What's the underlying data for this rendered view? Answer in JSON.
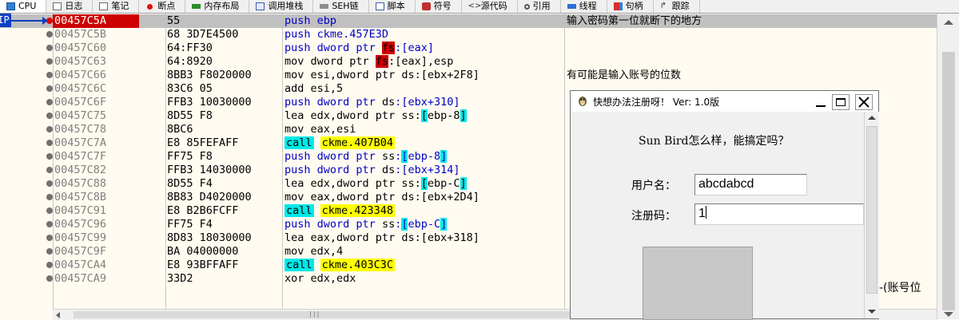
{
  "tabs": [
    {
      "label": "CPU",
      "icon": "cpu-icon"
    },
    {
      "label": "日志",
      "icon": "log-icon"
    },
    {
      "label": "笔记",
      "icon": "notes-icon"
    },
    {
      "label": "断点",
      "icon": "breakpoint-icon"
    },
    {
      "label": "内存布局",
      "icon": "memory-map-icon"
    },
    {
      "label": "调用堆栈",
      "icon": "call-stack-icon"
    },
    {
      "label": "SEH链",
      "icon": "seh-chain-icon"
    },
    {
      "label": "脚本",
      "icon": "script-icon"
    },
    {
      "label": "符号",
      "icon": "symbols-icon"
    },
    {
      "label": "源代码",
      "icon": "source-icon"
    },
    {
      "label": "引用",
      "icon": "references-icon"
    },
    {
      "label": "线程",
      "icon": "threads-icon"
    },
    {
      "label": "句柄",
      "icon": "handles-icon"
    },
    {
      "label": "跟踪",
      "icon": "trace-icon"
    }
  ],
  "eip_label": "EIP",
  "disasm": {
    "rows": [
      {
        "addr": "00457C5A",
        "bytes": "55",
        "comment": "输入密码第一位就断下的地方"
      },
      {
        "addr": "00457C5B",
        "bytes": "68 3D7E4500",
        "comment": ""
      },
      {
        "addr": "00457C60",
        "bytes": "64:FF30",
        "comment": ""
      },
      {
        "addr": "00457C63",
        "bytes": "64:8920",
        "comment": ""
      },
      {
        "addr": "00457C66",
        "bytes": "8BB3 F8020000",
        "comment": "有可能是输入账号的位数"
      },
      {
        "addr": "00457C6C",
        "bytes": "83C6 05",
        "comment": ""
      },
      {
        "addr": "00457C6F",
        "bytes": "FFB3 10030000",
        "comment": ""
      },
      {
        "addr": "00457C75",
        "bytes": "8D55 F8",
        "comment": ""
      },
      {
        "addr": "00457C78",
        "bytes": "8BC6",
        "comment": ""
      },
      {
        "addr": "00457C7A",
        "bytes": "E8 85FEFAFF",
        "comment": ""
      },
      {
        "addr": "00457C7F",
        "bytes": "FF75 F8",
        "comment": ""
      },
      {
        "addr": "00457C82",
        "bytes": "FFB3 14030000",
        "comment": ""
      },
      {
        "addr": "00457C88",
        "bytes": "8D55 F4",
        "comment": ""
      },
      {
        "addr": "00457C8B",
        "bytes": "8B83 D4020000",
        "comment": ""
      },
      {
        "addr": "00457C91",
        "bytes": "E8 B2B6FCFF",
        "comment": ""
      },
      {
        "addr": "00457C96",
        "bytes": "FF75 F4",
        "comment": ""
      },
      {
        "addr": "00457C99",
        "bytes": "8D83 18030000",
        "comment": ""
      },
      {
        "addr": "00457C9F",
        "bytes": "BA 04000000",
        "comment": ""
      },
      {
        "addr": "00457CA4",
        "bytes": "E8 93BFFAFF",
        "comment": ""
      },
      {
        "addr": "00457CA9",
        "bytes": "33D2",
        "comment": ""
      }
    ],
    "asm": {
      "r0": {
        "mn": "push",
        "op": "ebp"
      },
      "r1": {
        "mn": "push",
        "op": "ckme.457E3D"
      },
      "r2": {
        "mn": "push",
        "pre": "dword ptr ",
        "seg": "fs",
        "post": ":[eax]"
      },
      "r3": {
        "mn": "mov",
        "pre": "dword ptr ",
        "seg": "fs",
        "post": ":[eax],esp"
      },
      "r4": {
        "mn": "mov",
        "pre": "esi,dword ptr ",
        "seg": "ds",
        "post": ":[ebx+2F8]"
      },
      "r5": {
        "mn": "add",
        "op": "esi,5"
      },
      "r6": {
        "mn": "push",
        "pre": "dword ptr ",
        "seg": "ds",
        "post": ":[ebx+310]"
      },
      "r7": {
        "mn": "lea",
        "pre": "edx,dword ptr ",
        "seg": "ss",
        "post": ":[ebp-8]"
      },
      "r8": {
        "mn": "mov",
        "op": "eax,esi"
      },
      "r9": {
        "mn": "call",
        "target": "ckme.407B04"
      },
      "r10": {
        "mn": "push",
        "pre": "dword ptr ",
        "seg": "ss",
        "post": ":[ebp-8]"
      },
      "r11": {
        "mn": "push",
        "pre": "dword ptr ",
        "seg": "ds",
        "post": ":[ebx+314]"
      },
      "r12": {
        "mn": "lea",
        "pre": "edx,dword ptr ",
        "seg": "ss",
        "post": ":[ebp-C]"
      },
      "r13": {
        "mn": "mov",
        "pre": "eax,dword ptr ",
        "seg": "ds",
        "post": ":[ebx+2D4]"
      },
      "r14": {
        "mn": "call",
        "target": "ckme.423348"
      },
      "r15": {
        "mn": "push",
        "pre": "dword ptr ",
        "seg": "ss",
        "post": ":[ebp-C]"
      },
      "r16": {
        "mn": "lea",
        "pre": "eax,dword ptr ",
        "seg": "ds",
        "post": ":[ebx+318]"
      },
      "r17": {
        "mn": "mov",
        "op": "edx,4"
      },
      "r18": {
        "mn": "call",
        "target": "ckme.403C3C"
      },
      "r19": {
        "mn": "xor",
        "op": "edx,edx"
      }
    }
  },
  "dialog": {
    "title": "快想办法注册呀！ Ver: 1.0版",
    "question": "Sun Bird怎么样，能搞定吗？",
    "username_label": "用户名：",
    "username_value": "abcdabcd",
    "regcode_label": "注册码：",
    "regcode_value": "1"
  },
  "side_text": "-(账号位",
  "hscroll_grip": "|||",
  "colors": {
    "selected_addr_bg": "#cc0000",
    "call_bg": "#00e8e8",
    "call_target_bg": "#ffff00",
    "push_fg": "#0000c8",
    "eip_bg": "#1040c0"
  }
}
